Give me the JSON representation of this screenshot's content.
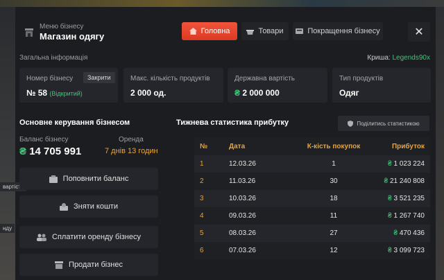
{
  "header": {
    "subtitle": "Меню бізнесу",
    "title": "Магазин одягу"
  },
  "nav": {
    "home": "Головна",
    "goods": "Товари",
    "upgrades": "Покращення бізнесу",
    "close": "✕"
  },
  "general": {
    "label": "Загальна інформація",
    "roof_label": "Криша:",
    "roof_value": "Legends90x"
  },
  "info": {
    "number_label": "Номер бізнесу",
    "close_button": "Закрити",
    "number_value": "№ 58",
    "open_status": "(Відкритий)",
    "max_products_label": "Макс. кількість продуктів",
    "max_products_value": "2 000 од.",
    "state_value_label": "Державна вартість",
    "state_value": "2 000 000",
    "product_type_label": "Тип продуктів",
    "product_type_value": "Одяг"
  },
  "control": {
    "title": "Основне керування бізнесом",
    "balance_label": "Баланс бізнесу",
    "balance_value": "14 705 991",
    "rent_label": "Оренда",
    "rent_value": "7 днів 13 годин",
    "topup": "Поповнити баланс",
    "withdraw": "Зняти кошти",
    "pay_rent": "Сплатити оренду бізнесу",
    "sell": "Продати бізнес",
    "side_tag_1": "вартість",
    "side_tag_2": "нду"
  },
  "stats": {
    "title": "Тижнева статистика прибутку",
    "share": "Поділитись статистикою",
    "columns": [
      "№",
      "Дата",
      "К-кість покупок",
      "Прибуток"
    ],
    "rows": [
      {
        "n": "1",
        "date": "12.03.26",
        "count": "1",
        "profit": "1 023 224"
      },
      {
        "n": "2",
        "date": "11.03.26",
        "count": "30",
        "profit": "21 240 808"
      },
      {
        "n": "3",
        "date": "10.03.26",
        "count": "18",
        "profit": "3 521 235"
      },
      {
        "n": "4",
        "date": "09.03.26",
        "count": "11",
        "profit": "1 267 740"
      },
      {
        "n": "5",
        "date": "08.03.26",
        "count": "27",
        "profit": "470 436"
      },
      {
        "n": "6",
        "date": "07.03.26",
        "count": "12",
        "profit": "3 099 723"
      }
    ]
  },
  "currency_symbol": "₴",
  "colors": {
    "accent": "#e8a33a",
    "primary_button": "#e8472f",
    "money_green": "#44c27a"
  }
}
